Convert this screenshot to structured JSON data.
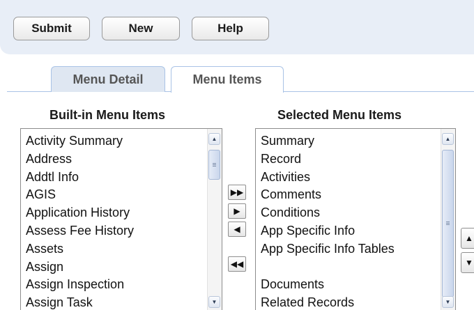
{
  "toolbar": {
    "submit_label": "Submit",
    "new_label": "New",
    "help_label": "Help"
  },
  "tabs": [
    {
      "label": "Menu Detail"
    },
    {
      "label": "Menu Items",
      "active": true
    }
  ],
  "builtin": {
    "header": "Built-in Menu Items",
    "items": [
      "Activity Summary",
      "Address",
      "Addtl Info",
      "AGIS",
      "Application History",
      "Assess Fee History",
      "Assets",
      "Assign",
      "Assign Inspection",
      "Assign Task"
    ]
  },
  "selected": {
    "header": "Selected Menu Items",
    "items": [
      "Summary",
      "Record",
      "Activities",
      "Comments",
      "Conditions",
      "App Specific Info",
      "App Specific Info Tables",
      "",
      "Documents",
      "Related Records"
    ]
  },
  "move_buttons": {
    "add_all_icon": "double-right-arrow",
    "add_one_icon": "right-arrow",
    "remove_one_icon": "left-arrow",
    "remove_all_icon": "double-left-arrow"
  },
  "order_buttons": {
    "up_icon": "up-arrow",
    "down_icon": "down-arrow"
  },
  "colors": {
    "toolbar_bg": "#e8eef7",
    "tab_border": "#a9c3e6",
    "scroll_thumb": "#c9d6ec"
  }
}
